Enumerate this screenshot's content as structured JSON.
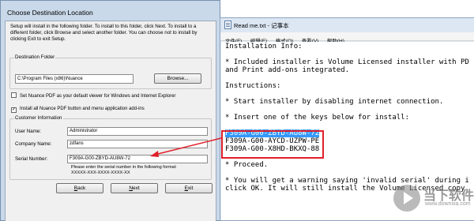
{
  "installer": {
    "title": "Choose Destination Location",
    "intro": "Setup will install in the following folder. To install to this folder, click Next. To install to a different folder, click Browse and select another folder. You can choose not to install by clicking Exit to exit Setup.",
    "destination": {
      "group_label": "Destination Folder",
      "path": "C:\\Program Files (x86)\\Nuance",
      "browse_label": "Browse..."
    },
    "options": [
      {
        "label": "Set Nuance PDF as your default viewer for Windows and Internet Explorer",
        "checked": false
      },
      {
        "label": "Install all Nuance PDF button and menu application add-ins",
        "checked": true
      }
    ],
    "customer": {
      "group_label": "Customer Information",
      "user_name_label": "User Name:",
      "user_name": "Administrator",
      "company_label": "Company Name:",
      "company": "zdfans",
      "serial_label": "Serial Number:",
      "serial": "F309A-G00-ZBYD-AU8W-72",
      "serial_hint": "Please enter the serial number in the following format:",
      "serial_format": "XXXXX-XXX-XXXX-XXXX-XX"
    },
    "buttons": {
      "back": "Back",
      "next": "Next",
      "exit": "Exit"
    }
  },
  "notepad": {
    "title": "Read me.txt - 记事本",
    "menu": [
      "文件(F)",
      "编辑(E)",
      "格式(O)",
      "查看(V)",
      "帮助(H)"
    ],
    "lines": [
      "Installation Info:",
      "",
      "* Included installer is Volume Licensed installer with PD",
      "and Print add-ons integrated.",
      "",
      "Instructions:",
      "",
      "* Start installer by disabling internet connection.",
      "",
      "* Insert one of the keys below for install:",
      "",
      "F309A-G00-ZBYD-AU8W-72",
      "F309A-G00-AYCD-UZPW-PE",
      "F309A-G00-X8HD-BKXQ-88",
      "",
      "* Proceed.",
      "",
      "* You will get a warning saying 'invalid serial' during i",
      "click OK. It will still install the Volume Licensed copy."
    ],
    "selected_line_index": 11
  },
  "watermark": {
    "cn": "当下软件园",
    "en": "www.downxia.com"
  },
  "colors": {
    "annotation_red": "#e0202a",
    "selection_blue": "#3399ff"
  }
}
